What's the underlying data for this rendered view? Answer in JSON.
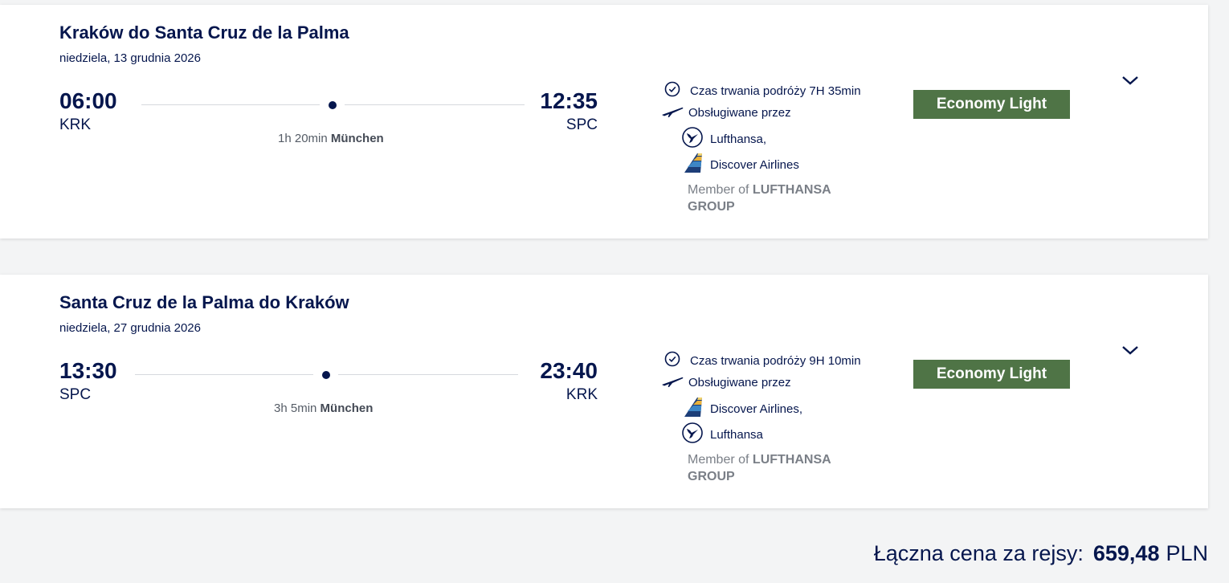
{
  "flights": [
    {
      "title": "Kraków do Santa Cruz de la Palma",
      "date": "niedziela, 13 grudnia 2026",
      "departure_time": "06:00",
      "departure_code": "KRK",
      "arrival_time": "12:35",
      "arrival_code": "SPC",
      "stop_duration": "1h 20min",
      "stop_city": "München",
      "duration_text": "Czas trwania podróży 7H 35min",
      "operated_by": "Obsługiwane przez",
      "airline_1": "Lufthansa,",
      "airline_2": "Discover Airlines",
      "member_prefix": "Member of",
      "member_group": "LUFTHANSA GROUP",
      "fare": "Economy Light"
    },
    {
      "title": "Santa Cruz de la Palma do Kraków",
      "date": "niedziela, 27 grudnia 2026",
      "departure_time": "13:30",
      "departure_code": "SPC",
      "arrival_time": "23:40",
      "arrival_code": "KRK",
      "stop_duration": "3h 5min",
      "stop_city": "München",
      "duration_text": "Czas trwania podróży 9H 10min",
      "operated_by": "Obsługiwane przez",
      "airline_1": "Discover Airlines,",
      "airline_2": "Lufthansa",
      "member_prefix": "Member of",
      "member_group": "LUFTHANSA GROUP",
      "fare": "Economy Light"
    }
  ],
  "total": {
    "label": "Łączna cena za rejsy:",
    "amount": "659,48",
    "currency": "PLN"
  },
  "icons": {
    "duration": "clock-check-icon",
    "operated": "airplane-icon",
    "lufthansa": "lufthansa-crane-logo",
    "discover": "discover-airlines-tail-logo",
    "expand": "chevron-down-icon"
  },
  "colors": {
    "navy": "#05164d",
    "fare_green": "#4f7446",
    "muted": "#7a7f87"
  }
}
